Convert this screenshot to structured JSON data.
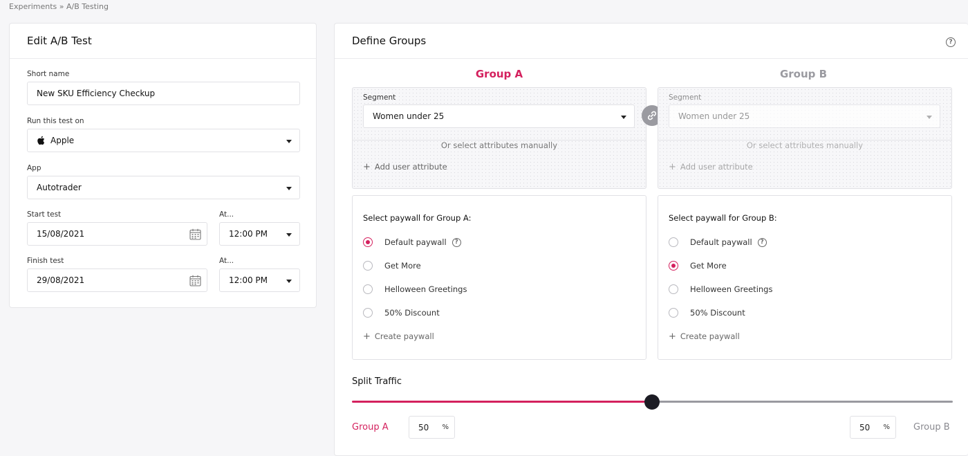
{
  "breadcrumb": "Experiments » A/B Testing",
  "edit": {
    "title": "Edit A/B Test",
    "short_name_label": "Short name",
    "short_name_value": "New SKU Efficiency Checkup",
    "run_on_label": "Run this test on",
    "run_on_value": "Apple",
    "app_label": "App",
    "app_value": "Autotrader",
    "start_label": "Start test",
    "start_value": "15/08/2021",
    "start_at_label": "At...",
    "start_time": "12:00 PM",
    "finish_label": "Finish test",
    "finish_value": "29/08/2021",
    "finish_at_label": "At...",
    "finish_time": "12:00 PM"
  },
  "groups": {
    "title": "Define Groups",
    "group_a": {
      "name": "Group A",
      "segment_label": "Segment",
      "segment_value": "Women under 25",
      "or_text": "Or select attributes manually",
      "add_attribute": "Add user attribute",
      "paywall_title": "Select paywall for Group A:",
      "paywalls": [
        "Default paywall",
        "Get More",
        "Helloween Greetings",
        "50% Discount"
      ],
      "selected_paywall": "Default paywall",
      "create_paywall": "Create paywall"
    },
    "group_b": {
      "name": "Group B",
      "segment_label": "Segment",
      "segment_value": "Women under 25",
      "or_text": "Or select attributes manually",
      "add_attribute": "Add user attribute",
      "paywall_title": "Select paywall for Group B:",
      "paywalls": [
        "Default paywall",
        "Get More",
        "Helloween Greetings",
        "50% Discount"
      ],
      "selected_paywall": "Get More",
      "create_paywall": "Create paywall"
    }
  },
  "split": {
    "title": "Split Traffic",
    "group_a_label": "Group A",
    "group_b_label": "Group B",
    "group_a_percent": "50",
    "group_b_percent": "50",
    "percent_sign": "%"
  },
  "colors": {
    "accent": "#d4215e",
    "muted": "#9a9aa0",
    "slider_thumb": "#1c1c24"
  }
}
